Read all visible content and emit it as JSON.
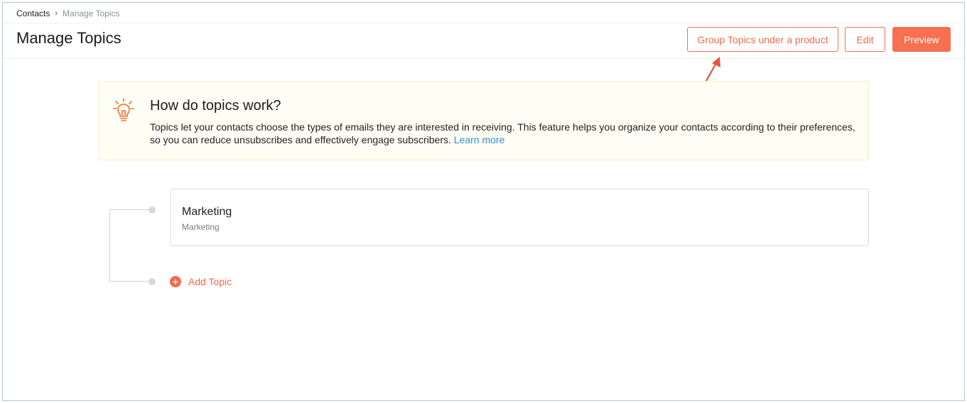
{
  "breadcrumb": {
    "parent": "Contacts",
    "separator": "›",
    "current": "Manage Topics"
  },
  "header": {
    "title": "Manage Topics",
    "buttons": {
      "group": "Group Topics under a product",
      "edit": "Edit",
      "preview": "Preview"
    }
  },
  "info": {
    "icon": "lightbulb-icon",
    "title": "How do topics work?",
    "text": "Topics let your contacts choose the types of emails they are interested in receiving. This feature helps you organize your contacts according to their preferences, so you can reduce unsubscribes and effectively engage subscribers.",
    "link": "Learn more"
  },
  "topics": [
    {
      "name": "Marketing",
      "description": "Marketing"
    }
  ],
  "add_topic": {
    "icon": "plus-circle-icon",
    "label": "Add Topic"
  },
  "colors": {
    "accent": "#f7704f",
    "link": "#2f8fd8",
    "info_bg": "#fefef4"
  }
}
